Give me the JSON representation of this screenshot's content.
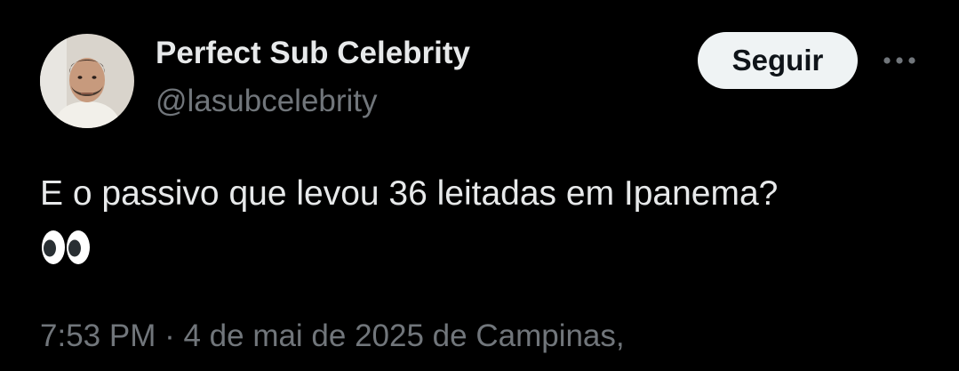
{
  "author": {
    "display_name": "Perfect Sub Celebrity",
    "handle": "@lasubcelebrity",
    "avatar_icon": "user-avatar-photo"
  },
  "actions": {
    "follow_label": "Seguir",
    "more_icon": "more-horizontal-icon"
  },
  "tweet": {
    "text": "E o passivo que levou 36 leitadas em Ipanema?",
    "emoji": "👀",
    "emoji_icon": "eyes-emoji"
  },
  "meta": {
    "time": "7:53 PM",
    "separator": " · ",
    "date": "4 de mai de 2025",
    "location": " de Campinas,"
  },
  "colors": {
    "background": "#000000",
    "text_primary": "#e7e9ea",
    "text_secondary": "#71767b",
    "button_bg": "#eff3f4",
    "button_text": "#0f1419"
  }
}
